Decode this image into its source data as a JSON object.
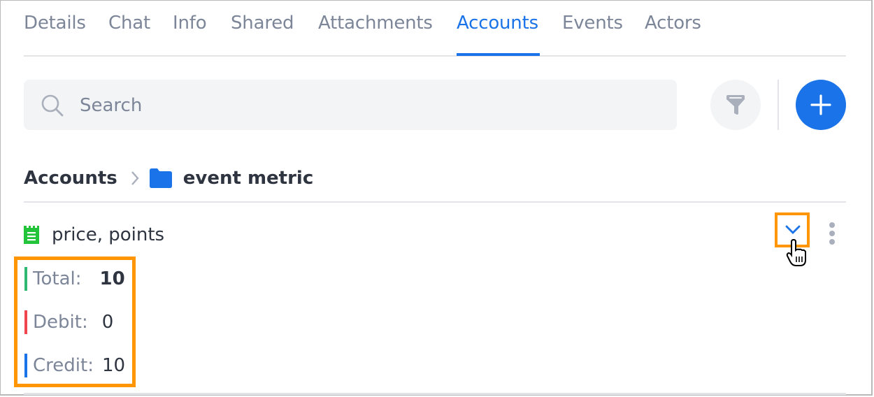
{
  "tabs": [
    {
      "label": "Details",
      "active": false
    },
    {
      "label": "Chat",
      "active": false
    },
    {
      "label": "Info",
      "active": false
    },
    {
      "label": "Shared",
      "active": false
    },
    {
      "label": "Attachments",
      "active": false
    },
    {
      "label": "Accounts",
      "active": true
    },
    {
      "label": "Events",
      "active": false
    },
    {
      "label": "Actors",
      "active": false
    }
  ],
  "search": {
    "placeholder": "Search",
    "value": "",
    "icon": "search-icon"
  },
  "toolbar": {
    "filter_icon": "filter-icon",
    "add_icon": "plus-icon"
  },
  "breadcrumb": {
    "root": "Accounts",
    "separator_icon": "chevron-right-icon",
    "folder_icon": "folder-icon",
    "current": "event metric"
  },
  "account": {
    "icon": "receipt-icon",
    "name": "price, points",
    "expand_icon": "chevron-down-icon",
    "more_icon": "more-vertical-icon",
    "stats": [
      {
        "label": "Total:",
        "value": "10",
        "color": "#2eb872"
      },
      {
        "label": "Debit:",
        "value": "0",
        "color": "#f0454f"
      },
      {
        "label": "Credit:",
        "value": "10",
        "color": "#1a73e8"
      }
    ]
  },
  "colors": {
    "accent": "#1a73e8",
    "highlight": "#ff9500",
    "account_icon": "#22c43a",
    "muted_text": "#7c8698",
    "text": "#2e3440"
  }
}
